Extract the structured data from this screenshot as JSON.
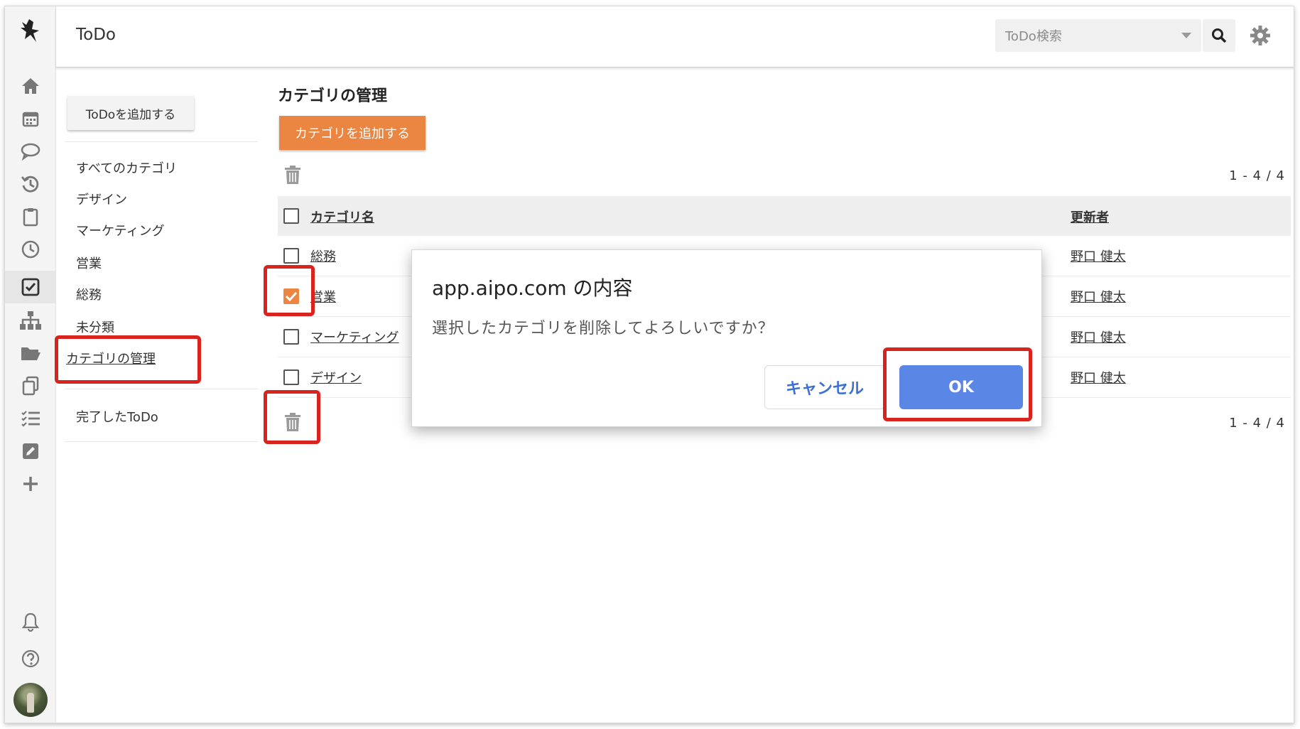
{
  "header": {
    "title": "ToDo",
    "search_placeholder": "ToDo検索",
    "search_icon": "search-icon",
    "settings_icon": "gear-icon"
  },
  "rail": {
    "icons": [
      "logo-icon",
      "home-icon",
      "calendar-icon",
      "chat-icon",
      "history-icon",
      "clipboard-icon",
      "clock-icon",
      "todo-check-icon",
      "org-chart-icon",
      "folder-icon",
      "copy-icon",
      "checklist-icon",
      "edit-icon",
      "plus-icon",
      "bell-icon",
      "help-icon"
    ],
    "active": "todo-check-icon"
  },
  "sidebar": {
    "add_todo_label": "ToDoを追加する",
    "categories": [
      "すべてのカテゴリ",
      "デザイン",
      "マーケティング",
      "営業",
      "総務",
      "未分類"
    ],
    "manage_label": "カテゴリの管理",
    "done_label": "完了したToDo"
  },
  "main": {
    "title": "カテゴリの管理",
    "add_category_label": "カテゴリを追加する",
    "pager_top": "1 - 4 / 4",
    "pager_bottom": "1 - 4 / 4",
    "columns": {
      "name": "カテゴリ名",
      "updater": "更新者"
    },
    "rows": [
      {
        "name": "総務",
        "updater": "野口 健太",
        "checked": false
      },
      {
        "name": "営業",
        "updater": "野口 健太",
        "checked": true
      },
      {
        "name": "マーケティング",
        "updater": "野口 健太",
        "checked": false
      },
      {
        "name": "デザイン",
        "updater": "野口 健太",
        "checked": false
      }
    ]
  },
  "dialog": {
    "title": "app.aipo.com の内容",
    "message": "選択したカテゴリを削除してよろしいですか？",
    "cancel_label": "キャンセル",
    "ok_label": "OK"
  },
  "colors": {
    "accent_orange": "#ea8542",
    "ok_blue": "#5a86e6",
    "annotation_red": "#d9231e"
  }
}
